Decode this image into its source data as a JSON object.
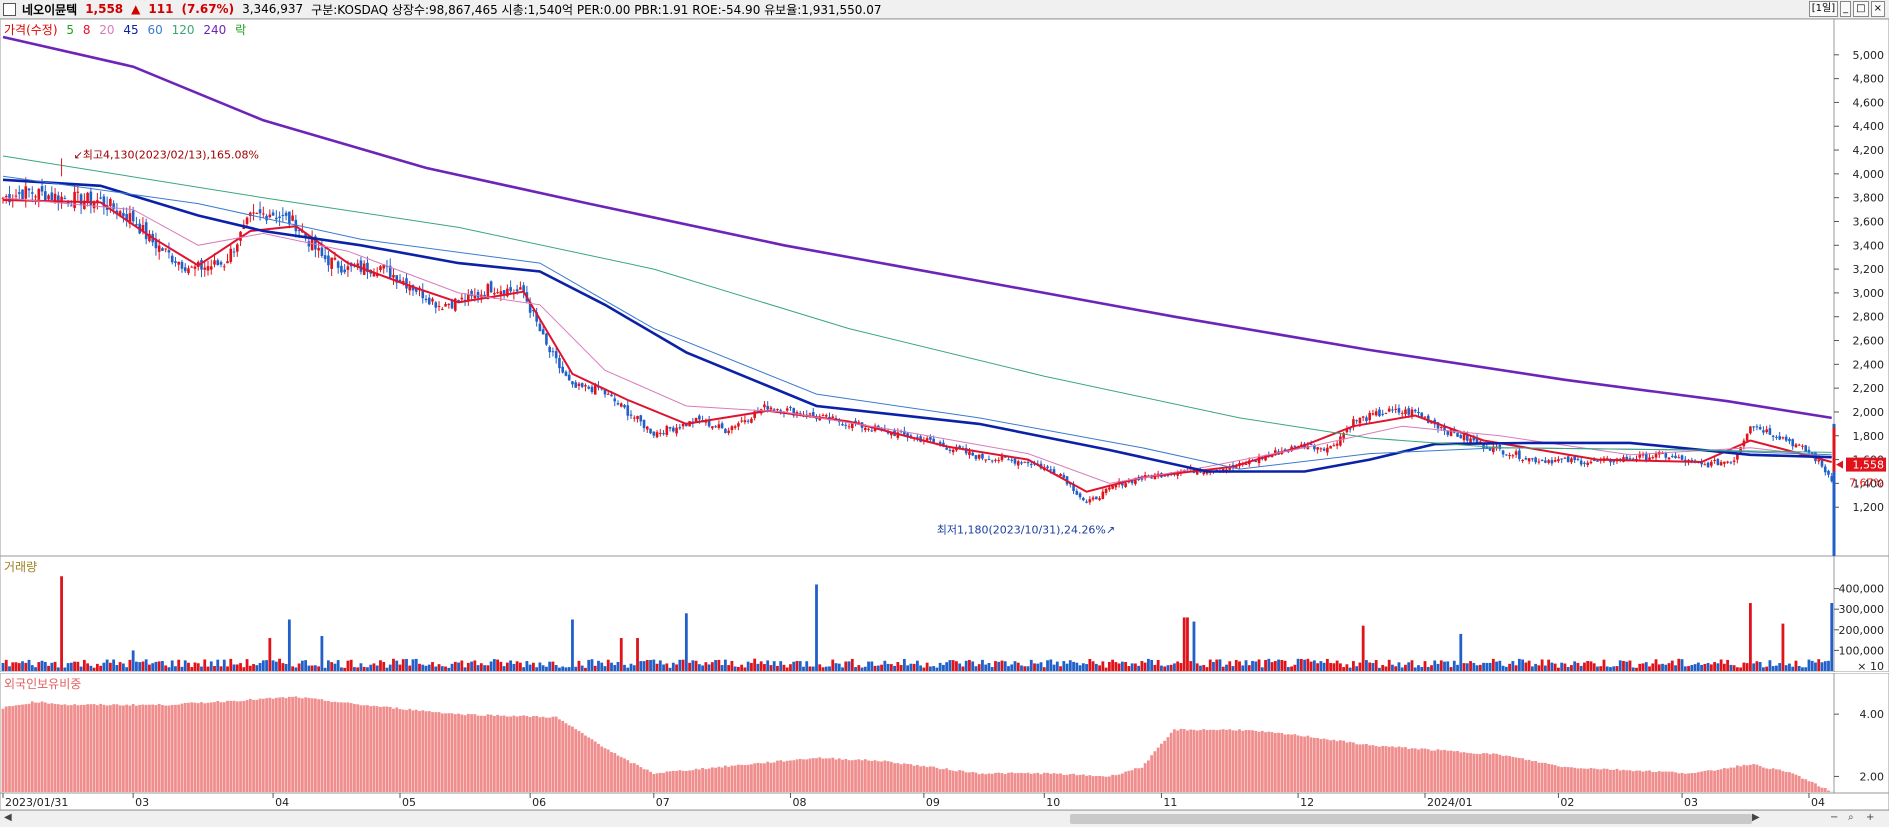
{
  "header": {
    "stock_name": "네오이뮨텍",
    "price": "1,558",
    "change_arrow": "▲",
    "change": "111",
    "change_pct": "(7.67%)",
    "volume": "3,346,937",
    "info": "구분:KOSDAQ 상장수:98,867,465 시총:1,540억 PER:0.00 PBR:1.91 ROE:-54.90 유보율:1,931,550.07",
    "period_label": "[1일]",
    "window_buttons": [
      "_",
      "□",
      "×"
    ]
  },
  "legend": {
    "price_label": "가격(수정)",
    "ma": [
      {
        "label": "5",
        "color": "#1fa31f"
      },
      {
        "label": "8",
        "color": "#e0132e"
      },
      {
        "label": "20",
        "color": "#d87bbb"
      },
      {
        "label": "45",
        "color": "#0b21a8"
      },
      {
        "label": "60",
        "color": "#3a7bd0"
      },
      {
        "label": "120",
        "color": "#3aa778"
      },
      {
        "label": "240",
        "color": "#6c25b8"
      }
    ],
    "extra": "락",
    "volume_label": "거래량",
    "foreign_label": "외국인보유비중"
  },
  "colors": {
    "up": "#e0131b",
    "down": "#2060c8",
    "foreign_bar": "#f08e8e"
  },
  "annotations": {
    "high": "최고4,130(2023/02/13),165.08%",
    "low": "최저1,180(2023/10/31),24.26%",
    "current_price": "1,558",
    "current_pct": "7.67%"
  },
  "chart_data": [
    {
      "type": "candlestick",
      "title": "가격(수정)",
      "ylim": [
        1000,
        5200
      ],
      "yticks": [
        "1,200",
        "1,400",
        "1,600",
        "1,800",
        "2,000",
        "2,200",
        "2,400",
        "2,600",
        "2,800",
        "3,000",
        "3,200",
        "3,400",
        "3,600",
        "3,800",
        "4,000",
        "4,200",
        "4,400",
        "4,600",
        "4,800",
        "5,000"
      ],
      "close_path": [
        [
          0,
          3800
        ],
        [
          8,
          3850
        ],
        [
          18,
          3800
        ],
        [
          30,
          3770
        ],
        [
          40,
          3620
        ],
        [
          45,
          3450
        ],
        [
          52,
          3300
        ],
        [
          58,
          3200
        ],
        [
          68,
          3250
        ],
        [
          76,
          3620
        ],
        [
          82,
          3680
        ],
        [
          90,
          3580
        ],
        [
          98,
          3300
        ],
        [
          106,
          3200
        ],
        [
          116,
          3220
        ],
        [
          126,
          3050
        ],
        [
          134,
          2900
        ],
        [
          144,
          2950
        ],
        [
          150,
          3050
        ],
        [
          160,
          3000
        ],
        [
          167,
          2550
        ],
        [
          175,
          2200
        ],
        [
          183,
          2200
        ],
        [
          192,
          2000
        ],
        [
          200,
          1820
        ],
        [
          214,
          1930
        ],
        [
          222,
          1850
        ],
        [
          235,
          2050
        ],
        [
          250,
          1960
        ],
        [
          266,
          1870
        ],
        [
          284,
          1760
        ],
        [
          300,
          1620
        ],
        [
          315,
          1580
        ],
        [
          325,
          1480
        ],
        [
          333,
          1230
        ],
        [
          343,
          1400
        ],
        [
          360,
          1500
        ],
        [
          378,
          1530
        ],
        [
          390,
          1650
        ],
        [
          400,
          1720
        ],
        [
          408,
          1700
        ],
        [
          415,
          1920
        ],
        [
          425,
          2000
        ],
        [
          434,
          2000
        ],
        [
          444,
          1840
        ],
        [
          455,
          1720
        ],
        [
          470,
          1600
        ],
        [
          490,
          1580
        ],
        [
          510,
          1640
        ],
        [
          522,
          1550
        ],
        [
          532,
          1600
        ],
        [
          537,
          1900
        ],
        [
          548,
          1770
        ],
        [
          556,
          1640
        ],
        [
          562,
          1440
        ]
      ],
      "ma_lines": [
        {
          "name": "8",
          "path": [
            [
              0,
              3780
            ],
            [
              30,
              3760
            ],
            [
              45,
              3480
            ],
            [
              60,
              3230
            ],
            [
              76,
              3520
            ],
            [
              90,
              3560
            ],
            [
              106,
              3250
            ],
            [
              126,
              3050
            ],
            [
              140,
              2920
            ],
            [
              160,
              3010
            ],
            [
              175,
              2320
            ],
            [
              192,
              2100
            ],
            [
              210,
              1900
            ],
            [
              235,
              2010
            ],
            [
              260,
              1920
            ],
            [
              290,
              1710
            ],
            [
              315,
              1600
            ],
            [
              333,
              1330
            ],
            [
              350,
              1450
            ],
            [
              378,
              1540
            ],
            [
              400,
              1720
            ],
            [
              415,
              1880
            ],
            [
              434,
              1970
            ],
            [
              455,
              1760
            ],
            [
              490,
              1600
            ],
            [
              522,
              1580
            ],
            [
              537,
              1760
            ],
            [
              562,
              1580
            ]
          ]
        },
        {
          "name": "20",
          "path": [
            [
              0,
              3800
            ],
            [
              40,
              3700
            ],
            [
              60,
              3400
            ],
            [
              80,
              3500
            ],
            [
              106,
              3350
            ],
            [
              140,
              3000
            ],
            [
              165,
              2900
            ],
            [
              185,
              2350
            ],
            [
              210,
              2050
            ],
            [
              240,
              2000
            ],
            [
              280,
              1820
            ],
            [
              315,
              1650
            ],
            [
              340,
              1400
            ],
            [
              370,
              1540
            ],
            [
              400,
              1700
            ],
            [
              430,
              1880
            ],
            [
              460,
              1800
            ],
            [
              500,
              1640
            ],
            [
              537,
              1700
            ],
            [
              562,
              1620
            ]
          ]
        },
        {
          "name": "45",
          "path": [
            [
              0,
              3950
            ],
            [
              30,
              3900
            ],
            [
              60,
              3650
            ],
            [
              80,
              3520
            ],
            [
              110,
              3400
            ],
            [
              140,
              3250
            ],
            [
              165,
              3180
            ],
            [
              185,
              2900
            ],
            [
              210,
              2500
            ],
            [
              250,
              2050
            ],
            [
              300,
              1900
            ],
            [
              340,
              1680
            ],
            [
              370,
              1500
            ],
            [
              400,
              1500
            ],
            [
              420,
              1600
            ],
            [
              440,
              1730
            ],
            [
              470,
              1740
            ],
            [
              500,
              1740
            ],
            [
              537,
              1640
            ],
            [
              562,
              1620
            ]
          ]
        },
        {
          "name": "60",
          "path": [
            [
              0,
              3980
            ],
            [
              60,
              3750
            ],
            [
              110,
              3450
            ],
            [
              165,
              3250
            ],
            [
              200,
              2700
            ],
            [
              250,
              2150
            ],
            [
              300,
              1950
            ],
            [
              350,
              1700
            ],
            [
              380,
              1520
            ],
            [
              420,
              1650
            ],
            [
              460,
              1700
            ],
            [
              520,
              1680
            ],
            [
              562,
              1640
            ]
          ]
        },
        {
          "name": "120",
          "path": [
            [
              0,
              4150
            ],
            [
              80,
              3800
            ],
            [
              140,
              3550
            ],
            [
              200,
              3200
            ],
            [
              260,
              2700
            ],
            [
              320,
              2300
            ],
            [
              380,
              1950
            ],
            [
              420,
              1780
            ],
            [
              460,
              1700
            ],
            [
              520,
              1680
            ],
            [
              562,
              1660
            ]
          ]
        },
        {
          "name": "240",
          "path": [
            [
              0,
              5150
            ],
            [
              40,
              4900
            ],
            [
              80,
              4450
            ],
            [
              130,
              4050
            ],
            [
              180,
              3750
            ],
            [
              240,
              3400
            ],
            [
              300,
              3100
            ],
            [
              360,
              2800
            ],
            [
              420,
              2520
            ],
            [
              480,
              2270
            ],
            [
              530,
              2090
            ],
            [
              562,
              1950
            ]
          ]
        }
      ],
      "high": [
        18,
        4130
      ],
      "low": [
        343,
        1180
      ]
    },
    {
      "type": "bar",
      "title": "거래량",
      "ylim": [
        0,
        500000
      ],
      "yticks": [
        "100,000",
        "200,000",
        "300,000",
        "400,000"
      ],
      "unit_label": "× 10",
      "spikes": [
        [
          18,
          460000
        ],
        [
          40,
          100000
        ],
        [
          82,
          160000
        ],
        [
          88,
          250000
        ],
        [
          98,
          170000
        ],
        [
          175,
          250000
        ],
        [
          190,
          160000
        ],
        [
          195,
          160000
        ],
        [
          210,
          280000
        ],
        [
          250,
          420000
        ],
        [
          363,
          260000
        ],
        [
          364,
          260000
        ],
        [
          366,
          240000
        ],
        [
          418,
          220000
        ],
        [
          448,
          180000
        ],
        [
          537,
          330000
        ],
        [
          547,
          230000
        ],
        [
          562,
          330000
        ]
      ]
    },
    {
      "type": "bar",
      "title": "외국인보유비중",
      "ylim": [
        1.5,
        5.0
      ],
      "yticks": [
        "2.00",
        "4.00"
      ],
      "path": [
        [
          0,
          4.2
        ],
        [
          10,
          4.4
        ],
        [
          20,
          4.3
        ],
        [
          50,
          4.3
        ],
        [
          90,
          4.55
        ],
        [
          110,
          4.3
        ],
        [
          140,
          4.0
        ],
        [
          170,
          3.9
        ],
        [
          190,
          2.6
        ],
        [
          200,
          2.1
        ],
        [
          220,
          2.3
        ],
        [
          250,
          2.6
        ],
        [
          270,
          2.5
        ],
        [
          300,
          2.1
        ],
        [
          320,
          2.1
        ],
        [
          340,
          2.0
        ],
        [
          350,
          2.3
        ],
        [
          360,
          3.5
        ],
        [
          380,
          3.5
        ],
        [
          400,
          3.3
        ],
        [
          420,
          3.0
        ],
        [
          460,
          2.7
        ],
        [
          480,
          2.3
        ],
        [
          520,
          2.1
        ],
        [
          537,
          2.4
        ],
        [
          550,
          2.1
        ],
        [
          562,
          1.5
        ]
      ]
    }
  ],
  "x_axis": {
    "labels": [
      "2023/01/31",
      "03",
      "04",
      "05",
      "06",
      "07",
      "08",
      "09",
      "10",
      "11",
      "12",
      "2024/01",
      "02",
      "03",
      "04"
    ],
    "label_index": [
      0,
      40,
      83,
      122,
      162,
      200,
      242,
      283,
      320,
      356,
      398,
      437,
      478,
      516,
      555
    ]
  },
  "scrollbar": {
    "zoom_icons": [
      "−",
      "⌕",
      "+"
    ]
  }
}
